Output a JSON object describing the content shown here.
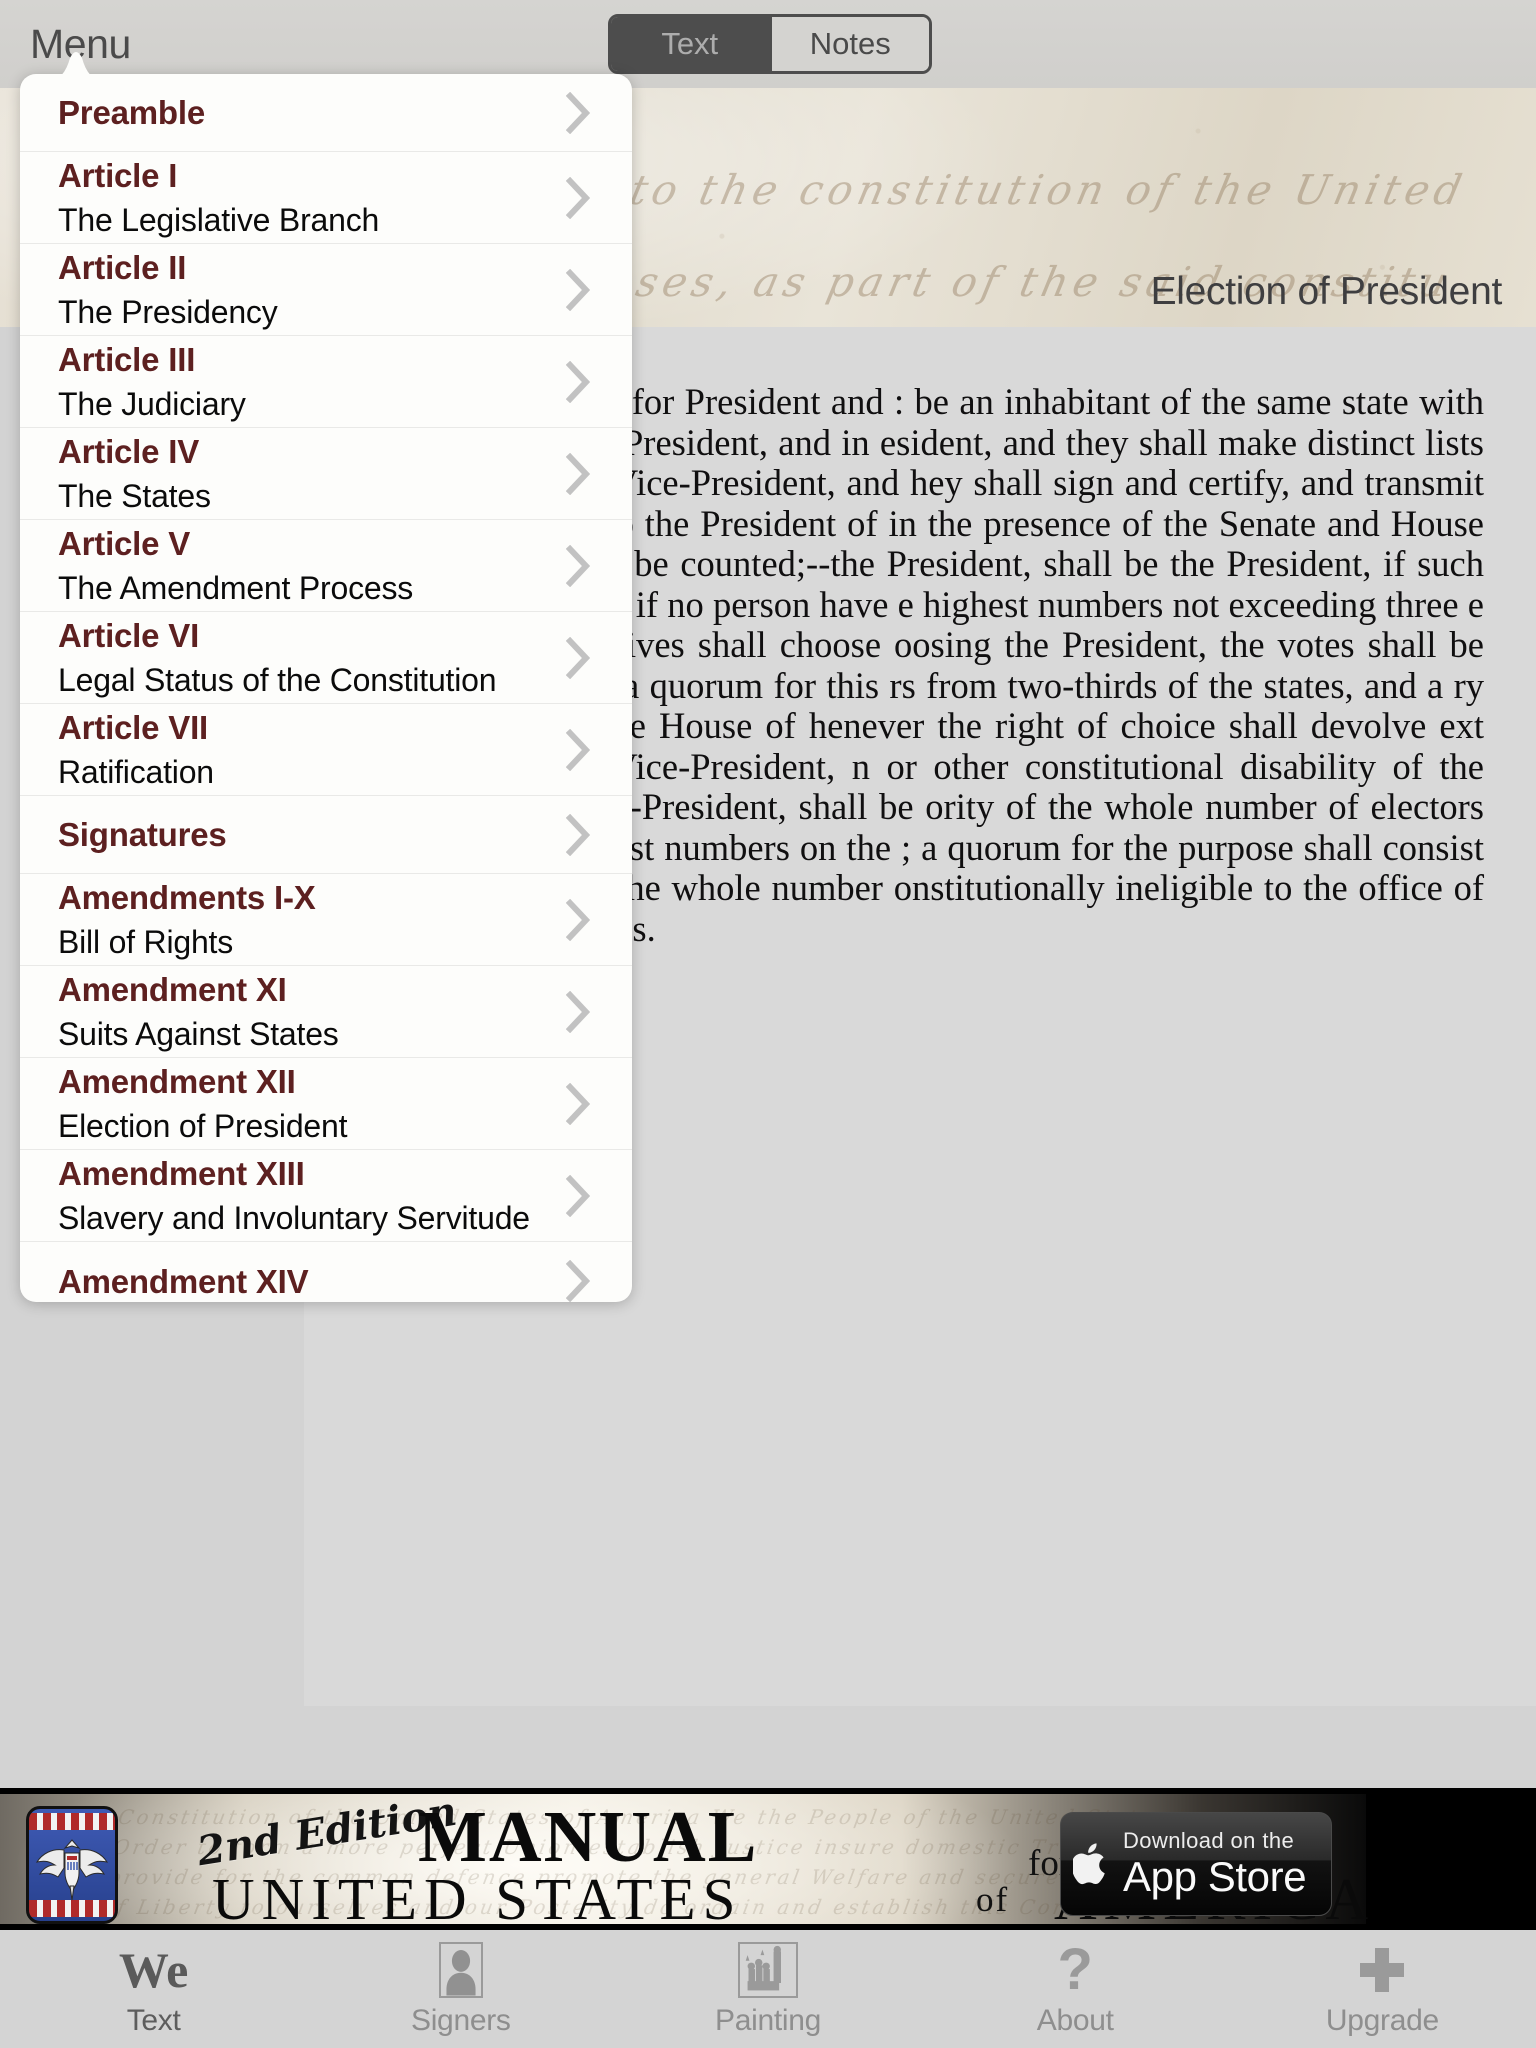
{
  "toolbar": {
    "menu_label": "Menu",
    "segments": [
      {
        "label": "Text",
        "selected": true
      },
      {
        "label": "Notes",
        "selected": false
      }
    ]
  },
  "reader": {
    "parchment": {
      "quill_line_1": "nt to the constitution of the United",
      "quill_line_2": "urposes, as part of the said constitu"
    },
    "section_title": "Election of President",
    "body_text": "tes and vote by ballot for President and : be an inhabitant of the same state with e person voted for as President, and in esident, and they shall make distinct lists persons voted for as Vice-President, and hey shall sign and certify, and transmit ited States, directed to the President of in the presence of the Senate and House d the votes shall then be counted;--the President, shall be the President, if such lectors appointed; and if no person have e highest numbers not exceeding three e House of Representatives shall choose oosing the President, the votes shall be tate having one vote; a quorum for this rs from two-thirds of the states, and a ry to a choice. And if the House of henever the right of choice shall devolve ext following, then the Vice-President, n or other constitutional disability of the mber of votes as Vice-President, shall be ority of the whole number of electors en from the two highest numbers on the ; a quorum for the purpose shall consist rs, and a majority of the whole number onstitutionally ineligible to the office of ent of the United States."
  },
  "menu": {
    "items": [
      {
        "title": "Preamble",
        "subtitle": ""
      },
      {
        "title": "Article I",
        "subtitle": "The Legislative Branch"
      },
      {
        "title": "Article II",
        "subtitle": "The Presidency"
      },
      {
        "title": "Article III",
        "subtitle": "The Judiciary"
      },
      {
        "title": "Article IV",
        "subtitle": "The States"
      },
      {
        "title": "Article V",
        "subtitle": "The Amendment Process"
      },
      {
        "title": "Article VI",
        "subtitle": "Legal Status of the Constitution"
      },
      {
        "title": "Article VII",
        "subtitle": "Ratification"
      },
      {
        "title": "Signatures",
        "subtitle": ""
      },
      {
        "title": "Amendments I-X",
        "subtitle": "Bill of Rights"
      },
      {
        "title": "Amendment XI",
        "subtitle": "Suits Against States"
      },
      {
        "title": "Amendment XII",
        "subtitle": "Election of President"
      },
      {
        "title": "Amendment XIII",
        "subtitle": "Slavery and Involuntary Servitude"
      },
      {
        "title": "Amendment XIV",
        "subtitle": ""
      }
    ]
  },
  "ad": {
    "edition": "2nd Edition",
    "manual": "MANUAL",
    "for_the": "for the",
    "united_states": "UNITED STATES",
    "of": "of",
    "america": "AMERICA",
    "faint_text": "Constitution of the United States of America We the People of the United States in Order to form a more perfect Union establish Justice insure domestic Tranquility provide for the common defence promote the general Welfare and secure the Blessings of Liberty to ourselves and our Posterity do ordain and establish this Constitution",
    "appstore_line1": "Download on the",
    "appstore_line2": "App Store"
  },
  "tabbar": {
    "items": [
      {
        "label": "Text",
        "icon": "we-serif-icon",
        "active": true
      },
      {
        "label": "Signers",
        "icon": "person-icon",
        "active": false
      },
      {
        "label": "Painting",
        "icon": "painting-icon",
        "active": false
      },
      {
        "label": "About",
        "icon": "question-icon",
        "active": false
      },
      {
        "label": "Upgrade",
        "icon": "plus-icon",
        "active": false
      }
    ]
  },
  "colors": {
    "accent_maroon": "#5d2020",
    "toolbar_gray": "#d3d2cf",
    "page_gray": "#d9d9d9",
    "segment_dark": "#4d4d4d"
  }
}
